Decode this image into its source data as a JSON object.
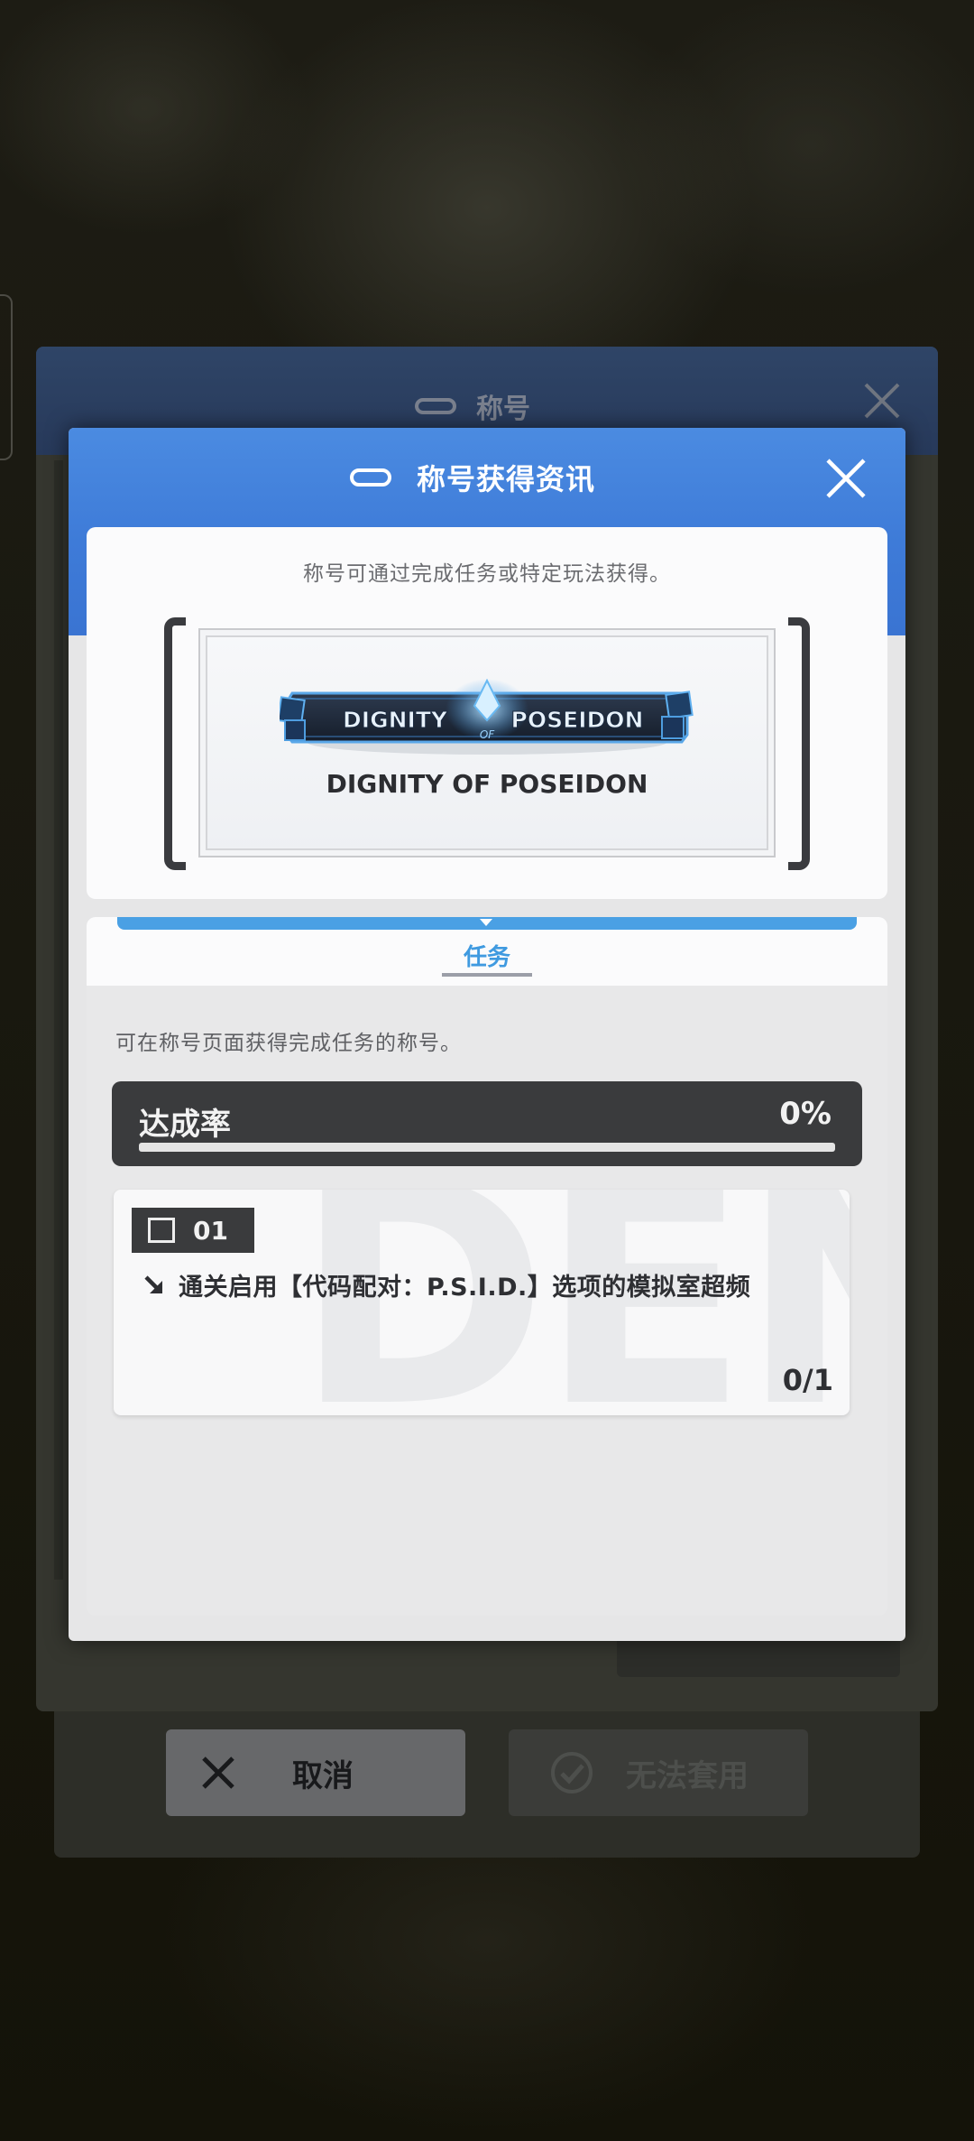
{
  "background": {
    "parent_dialog_title": "称号",
    "cancel_button_label": "取消",
    "cannot_button_label": "无法套用"
  },
  "modal": {
    "title": "称号获得资讯",
    "info": {
      "description": "称号可通过完成任务或特定玩法获得。",
      "title_name": "DIGNITY OF POSEIDON",
      "plate": {
        "left_word": "DIGNITY",
        "middle_word": "OF",
        "right_word": "POSEIDON"
      }
    },
    "tabs": [
      {
        "label": "任务",
        "active": true
      }
    ],
    "quest": {
      "description": "可在称号页面获得完成任务的称号。",
      "progress_label": "达成率",
      "progress_value": "0%",
      "progress_fraction": 0,
      "tasks": [
        {
          "number": "01",
          "text": "通关启用【代码配对：P.S.I.D.】选项的模拟室超频",
          "count": "0/1",
          "completed": false
        }
      ]
    }
  },
  "colors": {
    "header_blue": "#3e7bd8",
    "accent_blue": "#4aa0e4",
    "dark_panel": "#3a3b3d"
  }
}
